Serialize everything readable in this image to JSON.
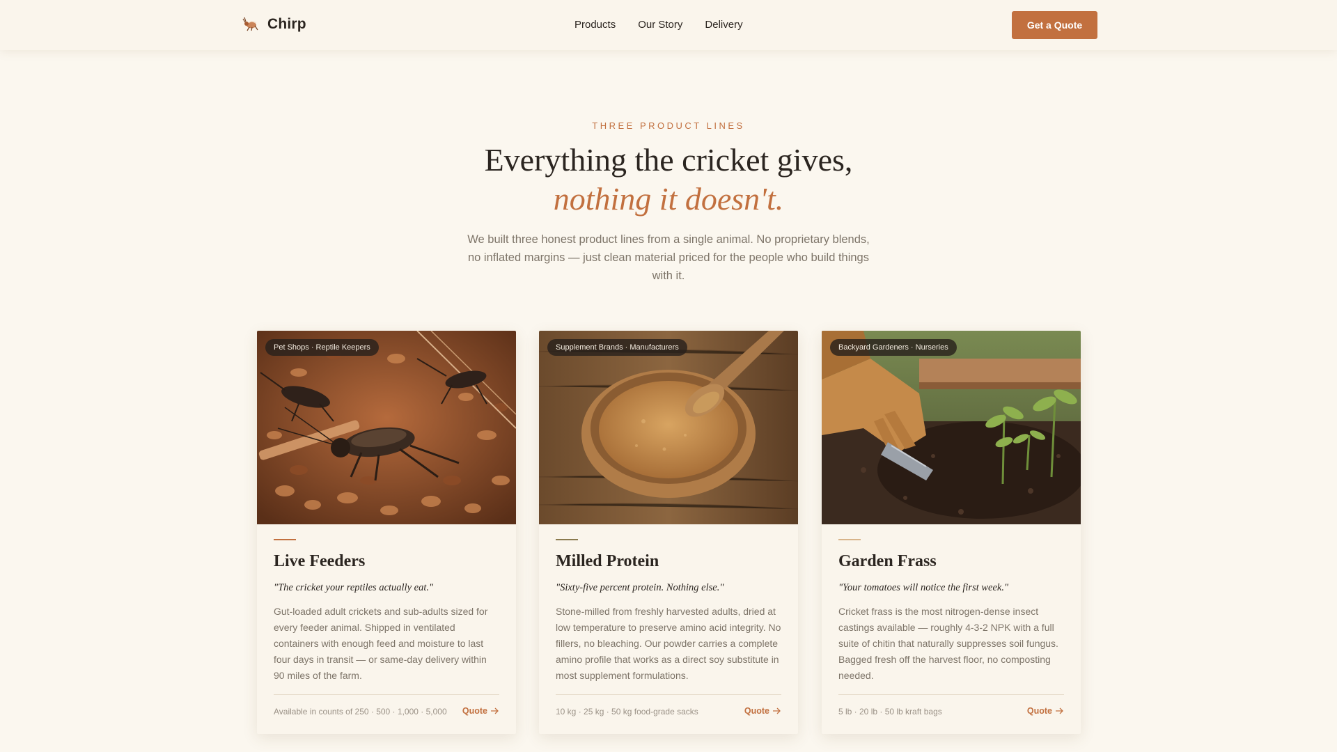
{
  "header": {
    "brand_name": "Chirp",
    "nav": [
      "Products",
      "Our Story",
      "Delivery"
    ],
    "cta_label": "Get a Quote"
  },
  "hero": {
    "eyebrow": "THREE PRODUCT LINES",
    "title_line1": "Everything the cricket gives,",
    "title_line2": "nothing it doesn't.",
    "lede": "We built three honest product lines from a single animal. No proprietary blends, no inflated margins — just clean material priced for the people who build things with it."
  },
  "products": [
    {
      "tag": "Pet Shops · Reptile Keepers",
      "title": "Live Feeders",
      "quote": "\"The cricket your reptiles actually eat.\"",
      "description": "Gut-loaded adult crickets and sub-adults sized for every feeder animal. Shipped in ventilated containers with enough feed and moisture to last four days in transit — or same-day delivery within 90 miles of the farm.",
      "sizes": "Available in counts of 250 · 500 · 1,000 · 5,000",
      "link_label": "Quote",
      "accent": "#c2703f",
      "image_icon": "crickets-photo"
    },
    {
      "tag": "Supplement Brands · Manufacturers",
      "title": "Milled Protein",
      "quote": "\"Sixty-five percent protein. Nothing else.\"",
      "description": "Stone-milled from freshly harvested adults, dried at low temperature to preserve amino acid integrity. No fillers, no bleaching. Our powder carries a complete amino profile that works as a direct soy substitute in most supplement formulations.",
      "sizes": "10 kg · 25 kg · 50 kg food-grade sacks",
      "link_label": "Quote",
      "accent": "#8a7a4e",
      "image_icon": "protein-powder-photo"
    },
    {
      "tag": "Backyard Gardeners · Nurseries",
      "title": "Garden Frass",
      "quote": "\"Your tomatoes will notice the first week.\"",
      "description": "Cricket frass is the most nitrogen-dense insect castings available — roughly 4-3-2 NPK with a full suite of chitin that naturally suppresses soil fungus. Bagged fresh off the harvest floor, no composting needed.",
      "sizes": "5 lb · 20 lb · 50 lb kraft bags",
      "link_label": "Quote",
      "accent": "#d8b48a",
      "image_icon": "garden-soil-photo"
    }
  ],
  "colors": {
    "background": "#fbf7ef",
    "accent": "#c2703f",
    "text": "#2b2520",
    "muted": "#7d7468"
  }
}
